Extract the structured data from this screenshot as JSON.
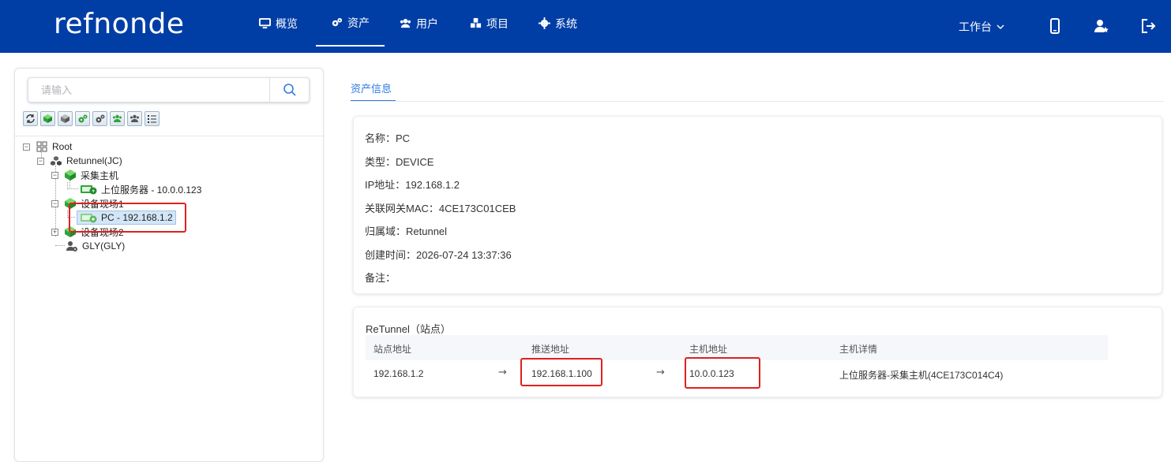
{
  "header": {
    "logo": "refnonde",
    "nav": [
      {
        "label": "概览",
        "icon": "monitor-icon"
      },
      {
        "label": "资产",
        "icon": "gears-icon"
      },
      {
        "label": "用户",
        "icon": "users-icon"
      },
      {
        "label": "项目",
        "icon": "cubes-icon"
      },
      {
        "label": "系统",
        "icon": "gear-icon"
      }
    ],
    "active_nav": "资产",
    "workbench": "工作台",
    "icons": [
      "mobile-icon",
      "user-star-icon",
      "logout-icon"
    ]
  },
  "sidebar": {
    "search_placeholder": "请输入",
    "toolbar_icons": [
      "refresh-icon",
      "cube-green-icon",
      "cube-gray-icon",
      "gears-green-icon",
      "gears-gray-icon",
      "users-green-icon",
      "users-gray-icon",
      "list-icon"
    ],
    "tree": {
      "root": "Root",
      "tunnel": "Retunnel(JC)",
      "collect_host": "采集主机",
      "upper_server": "上位服务器 - 10.0.0.123",
      "site1": "设备现场1",
      "pc": "PC - 192.168.1.2",
      "site2": "设备现场2",
      "gly": "GLY(GLY)"
    }
  },
  "main": {
    "tab": "资产信息",
    "info": {
      "name": "名称：PC",
      "type": "类型：DEVICE",
      "ip": "IP地址：192.168.1.2",
      "mac": "关联网关MAC：4CE173C01CEB",
      "domain": "归属域：Retunnel",
      "created": "创建时间：2026-07-24 13:37:36",
      "note": "备注："
    },
    "table": {
      "title": "ReTunnel（站点）",
      "columns": [
        "站点地址",
        "推送地址",
        "主机地址",
        "主机详情"
      ],
      "row": {
        "site_addr": "192.168.1.2",
        "push_addr": "192.168.1.100",
        "host_addr": "10.0.0.123",
        "host_detail": "上位服务器-采集主机(4CE173C014C4)"
      },
      "arrow": "→"
    }
  },
  "colors": {
    "header_bg": "#003ea6",
    "accent": "#2f7de1",
    "highlight": "#e02020"
  }
}
